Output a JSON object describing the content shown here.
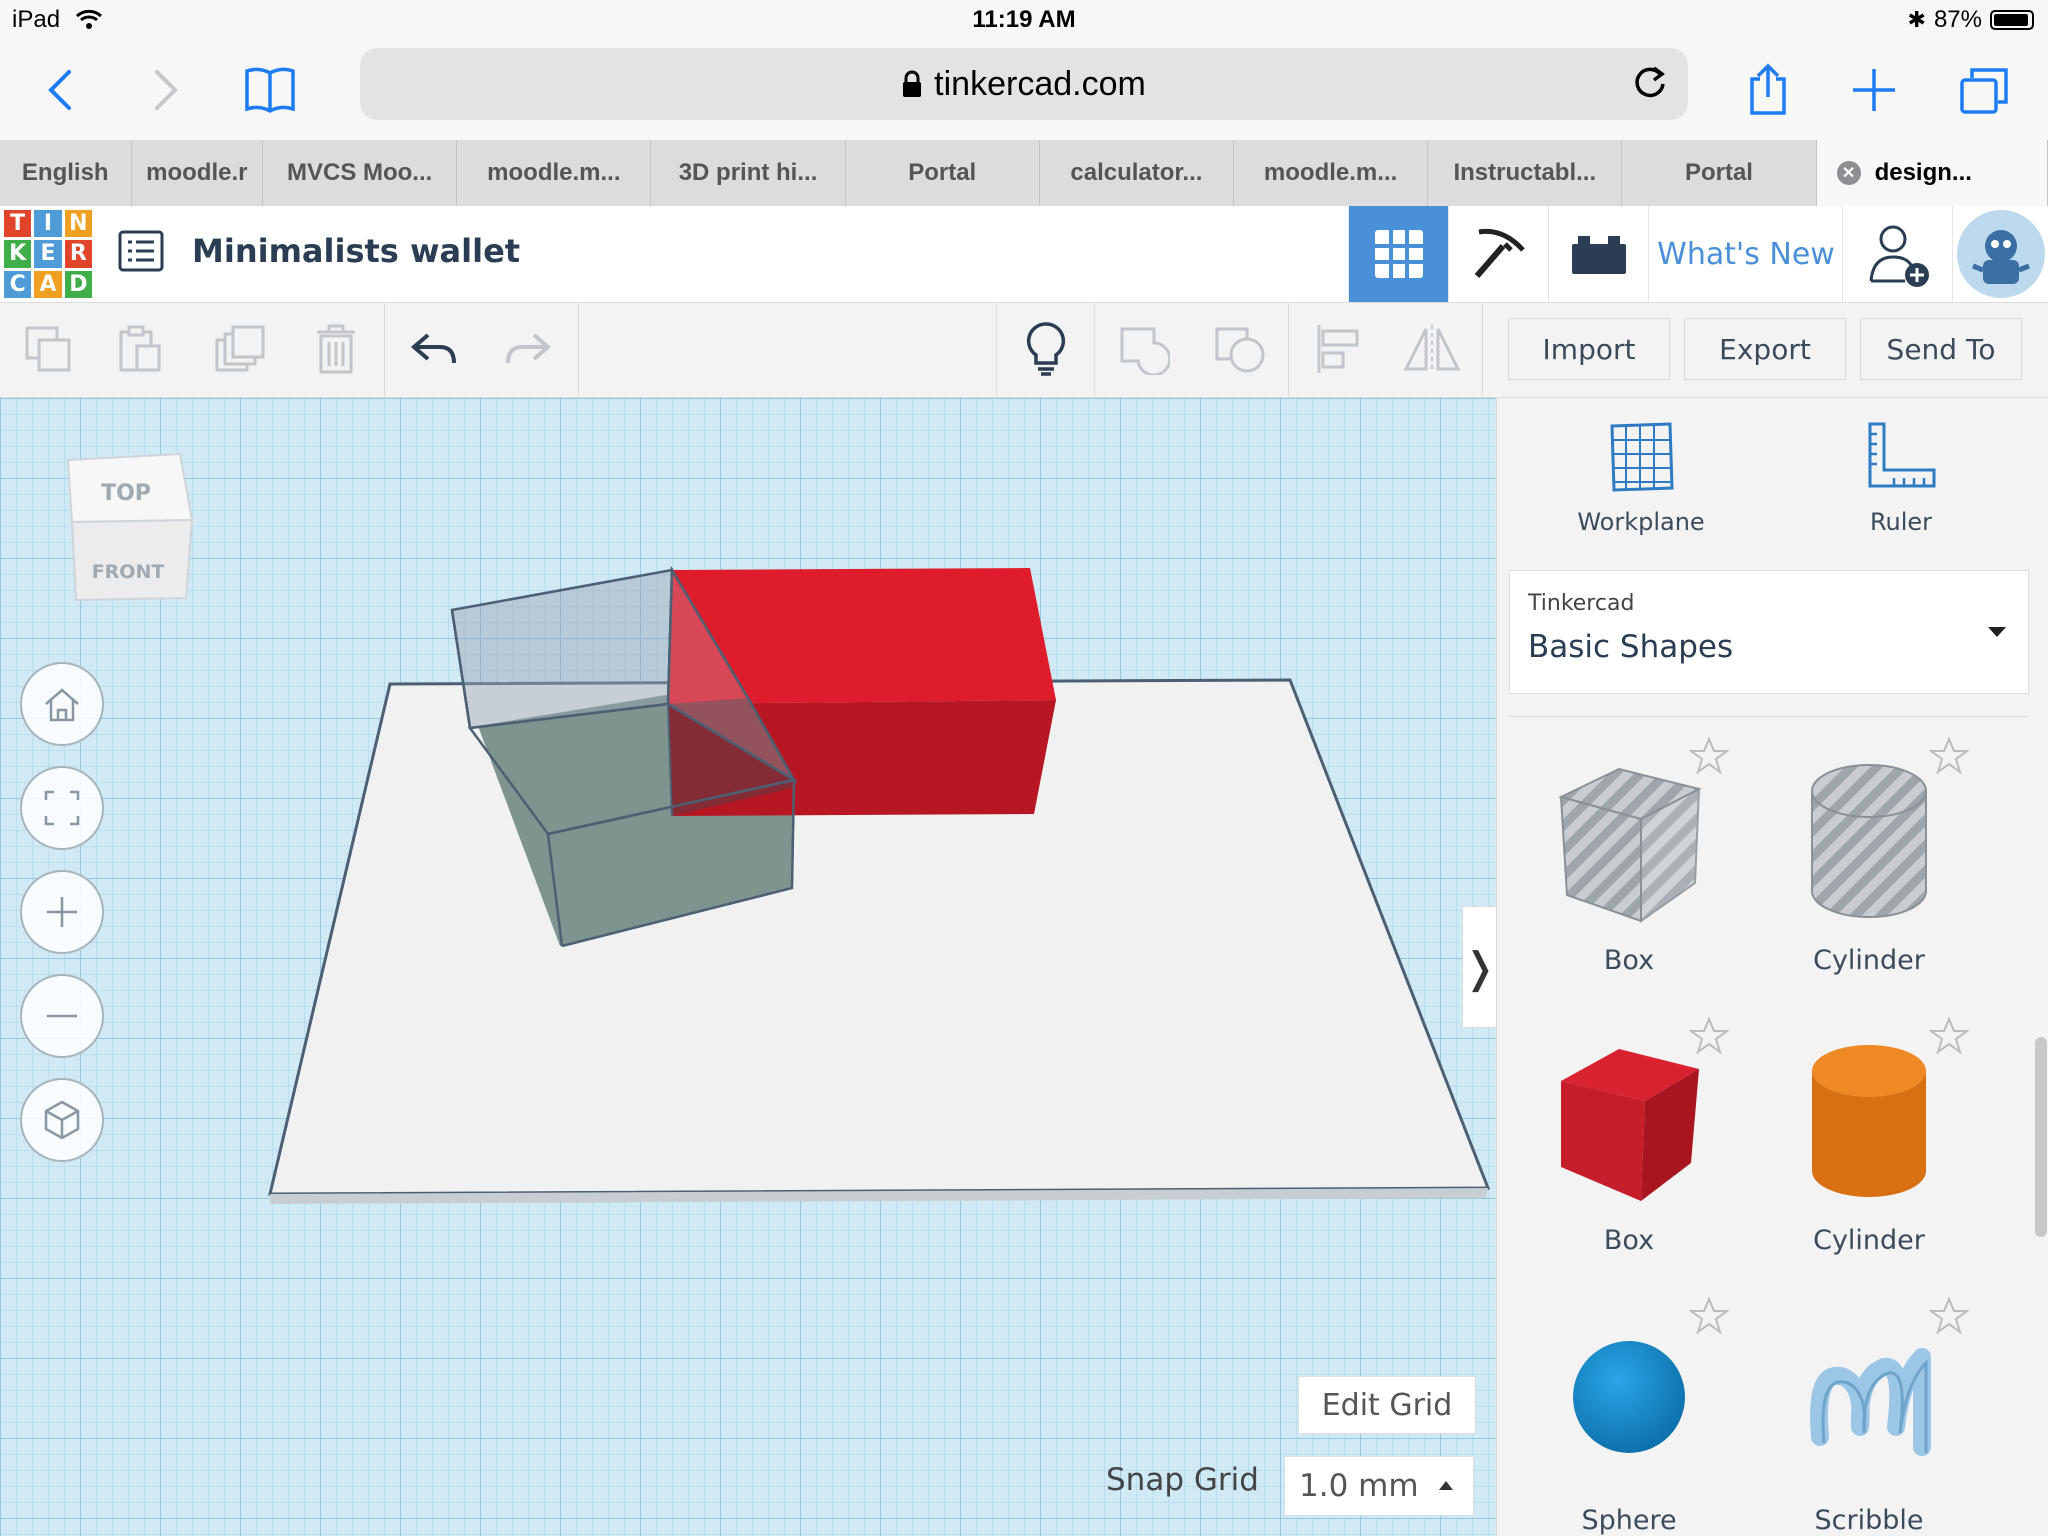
{
  "status_bar": {
    "device": "iPad",
    "time": "11:19 AM",
    "battery": "87%",
    "battery_level": 0.87
  },
  "browser": {
    "url": "tinkercad.com",
    "tabs": [
      {
        "label": "English"
      },
      {
        "label": "moodle.r"
      },
      {
        "label": "MVCS Moo..."
      },
      {
        "label": "moodle.m..."
      },
      {
        "label": "3D print hi..."
      },
      {
        "label": "Portal"
      },
      {
        "label": "calculator..."
      },
      {
        "label": "moodle.m..."
      },
      {
        "label": "Instructabl..."
      },
      {
        "label": "Portal"
      },
      {
        "label": "design..."
      }
    ]
  },
  "app": {
    "logo_letters": [
      "T",
      "I",
      "N",
      "K",
      "E",
      "R",
      "C",
      "A",
      "D"
    ],
    "logo_colors": [
      "#e0452b",
      "#4f9bd8",
      "#f0a020",
      "#3fae49",
      "#4f9bd8",
      "#e0452b",
      "#4f9bd8",
      "#f0a020",
      "#3fae49"
    ],
    "design_title": "Minimalists wallet",
    "whats_new": "What's New",
    "accent": "#4a90d9"
  },
  "toolbar": {
    "import": "Import",
    "export": "Export",
    "send_to": "Send To"
  },
  "workspace": {
    "viewcube": {
      "top": "TOP",
      "front": "FRONT"
    },
    "edit_grid": "Edit Grid",
    "snap_grid_label": "Snap Grid",
    "snap_grid_value": "1.0 mm"
  },
  "panel": {
    "workplane": "Workplane",
    "ruler": "Ruler",
    "library_vendor": "Tinkercad",
    "library_name": "Basic Shapes",
    "shapes": [
      {
        "label": "Box",
        "kind": "box-hole"
      },
      {
        "label": "Cylinder",
        "kind": "cylinder-hole"
      },
      {
        "label": "Box",
        "kind": "box-solid",
        "color": "#cc1f2a"
      },
      {
        "label": "Cylinder",
        "kind": "cylinder-solid",
        "color": "#e07b1a"
      },
      {
        "label": "Sphere",
        "kind": "sphere",
        "color": "#1a8fd0"
      },
      {
        "label": "Scribble",
        "kind": "scribble",
        "color": "#9cc6e6"
      }
    ]
  }
}
